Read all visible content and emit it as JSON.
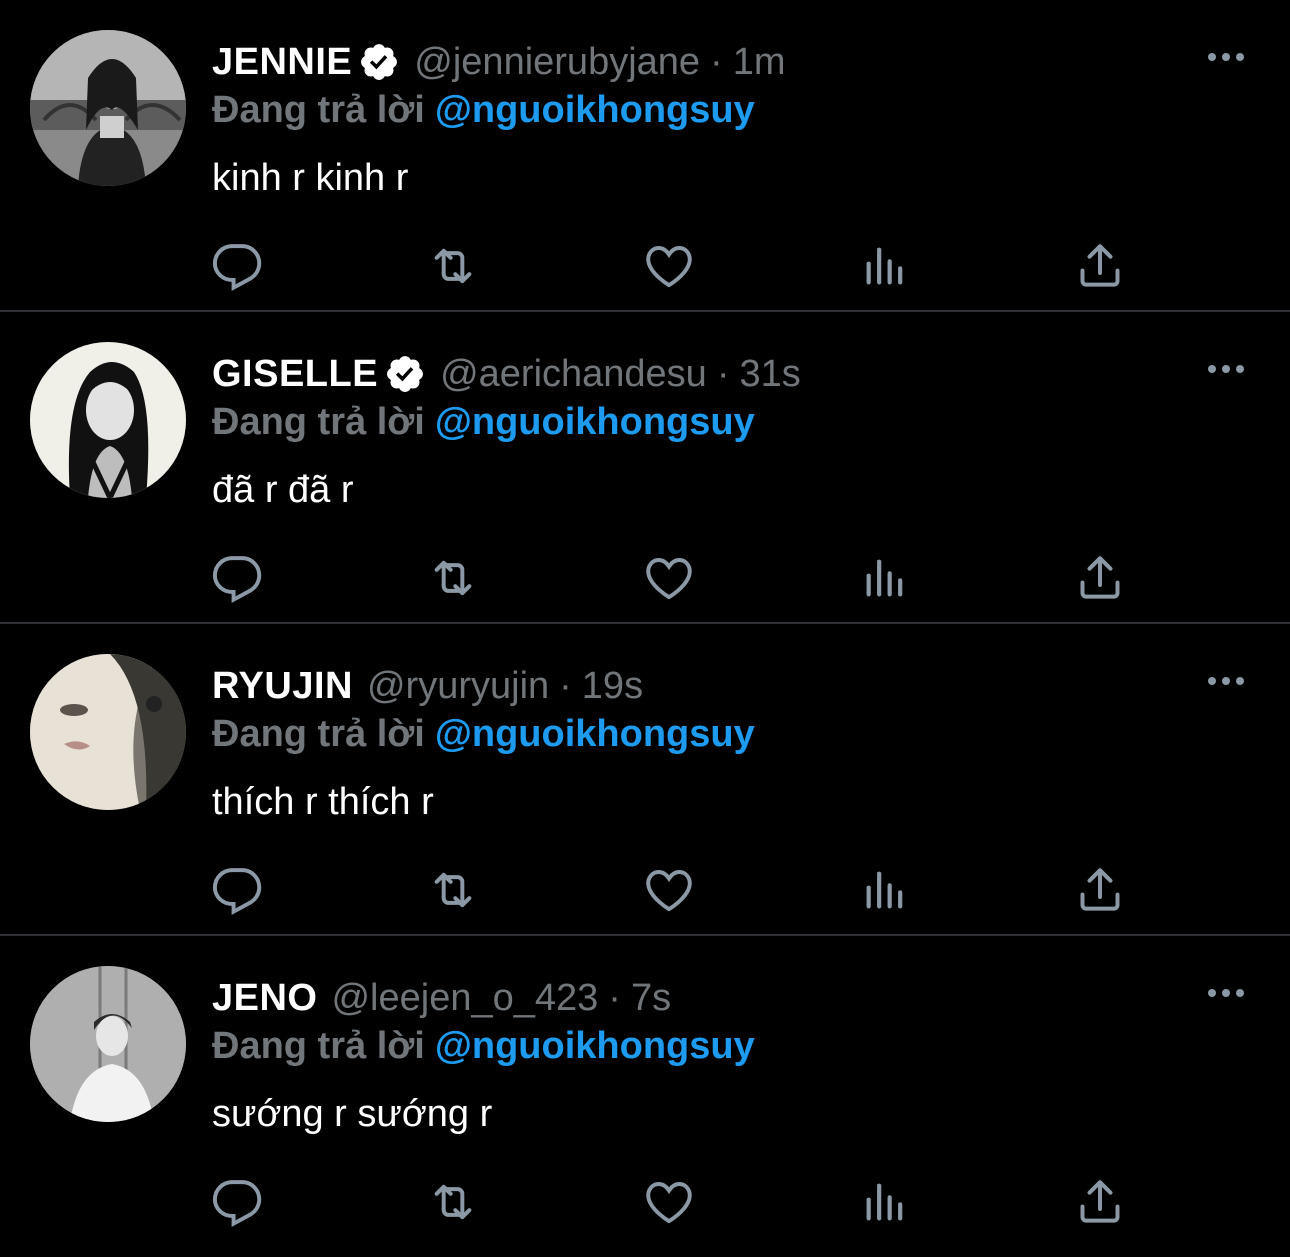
{
  "colors": {
    "background": "#000000",
    "name": "#ffffff",
    "secondary": "#71767b",
    "accent": "#1d9bf0",
    "divider": "#2f3336",
    "icon": "#8b98a5"
  },
  "tweets": [
    {
      "name": "JENNIE",
      "verified": true,
      "handle": "@jennierubyjane",
      "separator": "·",
      "time": "1m",
      "reply_label": "Đang trả lời",
      "reply_to": "@nguoikhongsuy",
      "text": "kinh r kinh r",
      "avatar": "avatar-jennie"
    },
    {
      "name": "GISELLE",
      "verified": true,
      "handle": "@aerichandesu",
      "separator": "·",
      "time": "31s",
      "reply_label": "Đang trả lời",
      "reply_to": "@nguoikhongsuy",
      "text": "đã r đã r",
      "avatar": "avatar-giselle"
    },
    {
      "name": "RYUJIN",
      "verified": false,
      "handle": "@ryuryujin",
      "separator": "·",
      "time": "19s",
      "reply_label": "Đang trả lời",
      "reply_to": "@nguoikhongsuy",
      "text": "thích r thích r",
      "avatar": "avatar-ryujin"
    },
    {
      "name": "JENO",
      "verified": false,
      "handle": "@leejen_o_423",
      "separator": "·",
      "time": "7s",
      "reply_label": "Đang trả lời",
      "reply_to": "@nguoikhongsuy",
      "text": "sướng r sướng r",
      "avatar": "avatar-jeno"
    }
  ],
  "icons": {
    "more": "more-dots-icon",
    "reply": "reply-bubble-icon",
    "retweet": "retweet-icon",
    "like": "heart-icon",
    "views": "views-bars-icon",
    "share": "share-upload-icon",
    "verified": "verified-badge-icon"
  }
}
